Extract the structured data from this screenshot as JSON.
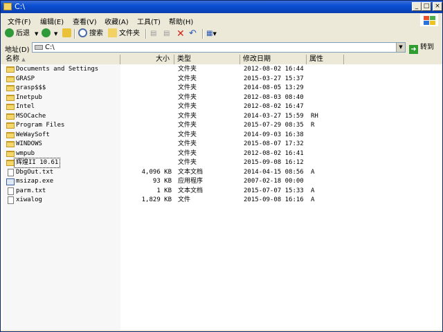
{
  "window": {
    "title": "C:\\"
  },
  "menu": [
    "文件(F)",
    "编辑(E)",
    "查看(V)",
    "收藏(A)",
    "工具(T)",
    "帮助(H)"
  ],
  "toolbar": {
    "back_label": "后退",
    "search_label": "搜索",
    "folders_label": "文件夹"
  },
  "address": {
    "label": "地址(D)",
    "value": "C:\\",
    "go_label": "转到"
  },
  "columns": {
    "name": "名称",
    "size": "大小",
    "type": "类型",
    "date": "修改日期",
    "attr": "属性"
  },
  "files": [
    {
      "name": "Documents and Settings",
      "size": "",
      "type": "文件夹",
      "date": "2012-08-02 16:44",
      "attr": "",
      "kind": "folder"
    },
    {
      "name": "GRASP",
      "size": "",
      "type": "文件夹",
      "date": "2015-03-27 15:37",
      "attr": "",
      "kind": "folder"
    },
    {
      "name": "grasp$$$",
      "size": "",
      "type": "文件夹",
      "date": "2014-08-05 13:29",
      "attr": "",
      "kind": "folder"
    },
    {
      "name": "Inetpub",
      "size": "",
      "type": "文件夹",
      "date": "2012-08-03 08:40",
      "attr": "",
      "kind": "folder"
    },
    {
      "name": "Intel",
      "size": "",
      "type": "文件夹",
      "date": "2012-08-02 16:47",
      "attr": "",
      "kind": "folder"
    },
    {
      "name": "MSOCache",
      "size": "",
      "type": "文件夹",
      "date": "2014-03-27 15:59",
      "attr": "RH",
      "kind": "folder"
    },
    {
      "name": "Program Files",
      "size": "",
      "type": "文件夹",
      "date": "2015-07-29 08:35",
      "attr": "R",
      "kind": "folder"
    },
    {
      "name": "WeWaySoft",
      "size": "",
      "type": "文件夹",
      "date": "2014-09-03 16:38",
      "attr": "",
      "kind": "folder"
    },
    {
      "name": "WINDOWS",
      "size": "",
      "type": "文件夹",
      "date": "2015-08-07 17:32",
      "attr": "",
      "kind": "folder"
    },
    {
      "name": "wmpub",
      "size": "",
      "type": "文件夹",
      "date": "2012-08-02 16:41",
      "attr": "",
      "kind": "folder"
    },
    {
      "name": "辉煌II 10.61",
      "size": "",
      "type": "文件夹",
      "date": "2015-09-08 16:12",
      "attr": "",
      "kind": "folder"
    },
    {
      "name": "DbgOut.txt",
      "size": "4,096 KB",
      "type": "文本文档",
      "date": "2014-04-15 08:56",
      "attr": "A",
      "kind": "file"
    },
    {
      "name": "msizap.exe",
      "size": "93 KB",
      "type": "应用程序",
      "date": "2007-02-18 00:00",
      "attr": "",
      "kind": "exe"
    },
    {
      "name": "parm.txt",
      "size": "1 KB",
      "type": "文本文档",
      "date": "2015-07-07 15:33",
      "attr": "A",
      "kind": "file"
    },
    {
      "name": "xiwalog",
      "size": "1,829 KB",
      "type": "文件",
      "date": "2015-09-08 16:16",
      "attr": "A",
      "kind": "file"
    }
  ]
}
